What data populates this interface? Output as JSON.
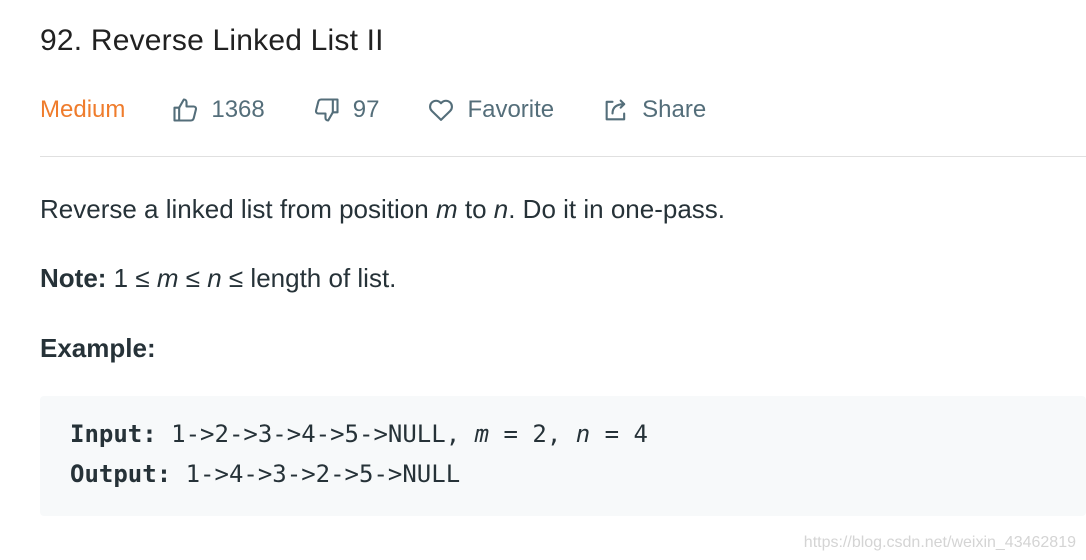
{
  "problem": {
    "title": "92. Reverse Linked List II",
    "difficulty": "Medium",
    "likes": "1368",
    "dislikes": "97",
    "favorite_label": "Favorite",
    "share_label": "Share"
  },
  "description": {
    "part1": "Reverse a linked list from position ",
    "var_m": "m",
    "part2": " to ",
    "var_n": "n",
    "part3": ". Do it in one-pass."
  },
  "note": {
    "label": "Note:",
    "part1": " 1 ≤ ",
    "var_m": "m",
    "part2": " ≤ ",
    "var_n": "n",
    "part3": " ≤ length of list."
  },
  "example": {
    "heading": "Example:",
    "input_label": "Input:",
    "input_value": " 1->2->3->4->5->NULL, ",
    "input_m_var": "m",
    "input_m_value": " = 2, ",
    "input_n_var": "n",
    "input_n_value": " = 4",
    "output_label": "Output:",
    "output_value": " 1->4->3->2->5->NULL"
  },
  "watermark": "https://blog.csdn.net/weixin_43462819",
  "colors": {
    "difficulty_medium": "#ef7c2c",
    "meta_text": "#546e7a",
    "code_bg": "#f7f9fa"
  },
  "icons": {
    "like": "thumbs-up-icon",
    "dislike": "thumbs-down-icon",
    "favorite": "heart-icon",
    "share": "share-icon"
  }
}
